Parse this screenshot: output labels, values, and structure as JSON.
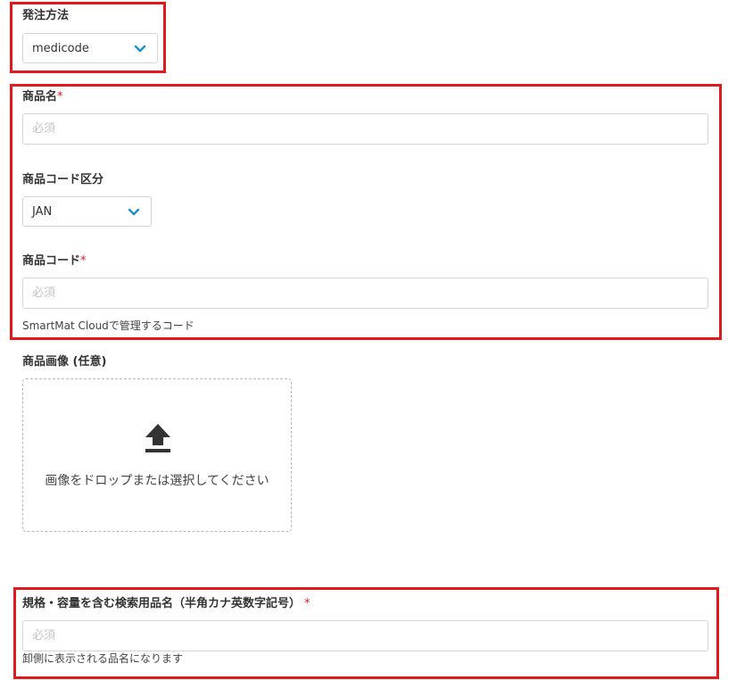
{
  "order_method": {
    "label": "発注方法",
    "selected": "medicode"
  },
  "product_name": {
    "label": "商品名",
    "required_mark": "*",
    "placeholder": "必須"
  },
  "product_code_type": {
    "label": "商品コード区分",
    "selected": "JAN"
  },
  "product_code": {
    "label": "商品コード",
    "required_mark": "*",
    "placeholder": "必須",
    "help": "SmartMat Cloudで管理するコード"
  },
  "product_image": {
    "label": "商品画像 (任意)",
    "dropzone_text": "画像をドロップまたは選択してください",
    "icon": "upload-icon"
  },
  "search_name": {
    "label": "規格・容量を含む検索用品名（半角カナ英数字記号）",
    "required_mark": "*",
    "placeholder": "必須",
    "help": "卸側に表示される品名になります"
  },
  "colors": {
    "highlight": "#e0191c",
    "chevron": "#1a8fd6",
    "required": "#e0191c"
  }
}
